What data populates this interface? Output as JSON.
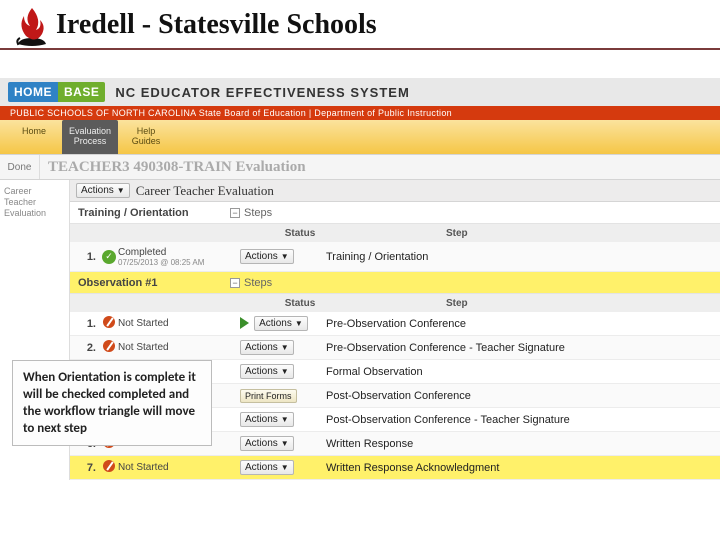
{
  "district_title": "Iredell - Statesville Schools",
  "homebase": {
    "logo_home": "HOME",
    "logo_base": "BASE",
    "system_name": "NC EDUCATOR EFFECTIVENESS SYSTEM",
    "sub_strip": "PUBLIC SCHOOLS OF NORTH CAROLINA   State Board of Education  |  Department of Public Instruction"
  },
  "tabs": [
    {
      "l1": "Home",
      "l2": ""
    },
    {
      "l1": "Evaluation",
      "l2": "Process"
    },
    {
      "l1": "Help",
      "l2": "Guides"
    }
  ],
  "done_label": "Done",
  "eval_title": "TEACHER3 490308-TRAIN Evaluation",
  "side_nav": "Career Teacher Evaluation",
  "actions_label": "Actions",
  "section1_label": "Career Teacher Evaluation",
  "steps_label": "Steps",
  "training_label": "Training / Orientation",
  "col_status": "Status",
  "col_step": "Step",
  "completed_status": "Completed",
  "completed_ts": "07/25/2013 @ 08:25 AM",
  "training_step_name": "Training / Orientation",
  "obs1_label": "Observation #1",
  "not_started": "Not Started",
  "print_forms": "Print Forms",
  "obs_steps": [
    "Pre-Observation Conference",
    "Pre-Observation Conference - Teacher Signature",
    "Formal Observation",
    "Post-Observation Conference",
    "Post-Observation Conference - Teacher Signature",
    "Written Response",
    "Written Response Acknowledgment"
  ],
  "callout_text": "When Orientation is complete it will be checked completed and the workflow triangle will move to next step"
}
